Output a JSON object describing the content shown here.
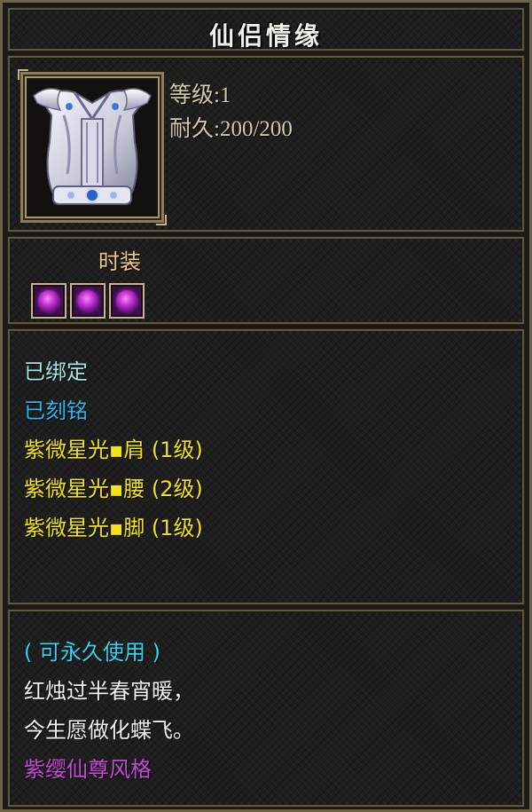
{
  "item": {
    "name": "仙侣情缘",
    "level_label": "等级:1",
    "durability_label": "耐久:200/200",
    "category": "时装",
    "icon": "white-armor-vest-icon",
    "gem_slots": [
      {
        "icon": "purple-gem-icon"
      },
      {
        "icon": "purple-gem-icon"
      },
      {
        "icon": "purple-gem-icon"
      }
    ]
  },
  "attributes": [
    {
      "text": "已绑定",
      "color": "#9ee6e6"
    },
    {
      "text": "已刻铭",
      "color": "#2fb6ee"
    },
    {
      "text": "紫微星光▪肩 (1级)",
      "color": "#f2e218"
    },
    {
      "text": "紫微星光▪腰 (2级)",
      "color": "#f2e218"
    },
    {
      "text": "紫微星光▪脚 (1级)",
      "color": "#f2e218"
    }
  ],
  "description": [
    {
      "text": "( 可永久使用 )",
      "color": "#2fd6ee"
    },
    {
      "text": "红烛过半春宵暖，",
      "color": "#f2f2ee"
    },
    {
      "text": "今生愿做化蝶飞。",
      "color": "#f2f2ee"
    },
    {
      "text": "紫缨仙尊风格",
      "color": "#c54ad6"
    }
  ]
}
